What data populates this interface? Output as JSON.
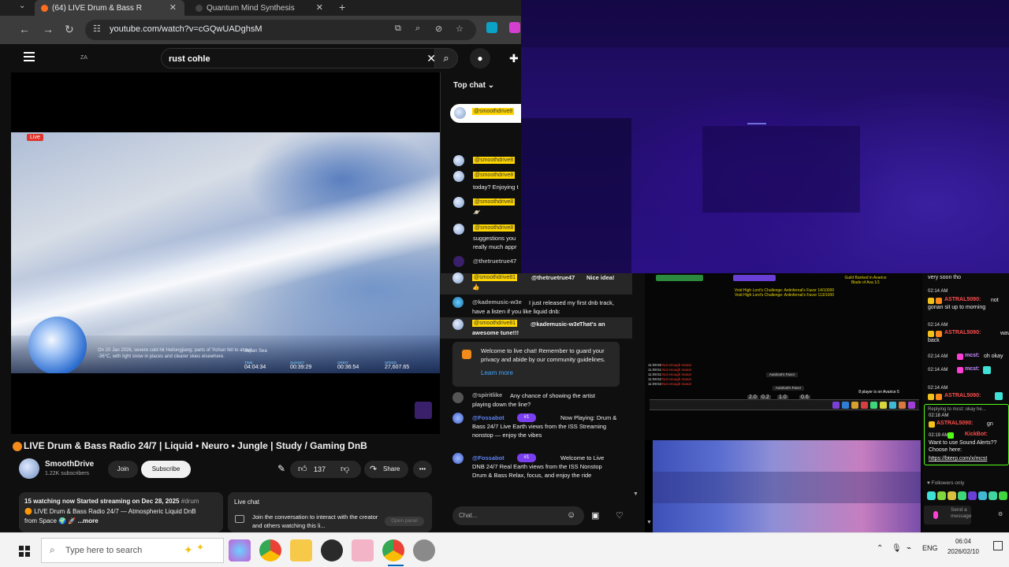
{
  "browser": {
    "tabs": [
      {
        "label": "(64)  LIVE Drum & Bass R"
      },
      {
        "label": "Quantum Mind Synthesis"
      }
    ],
    "url": "youtube.com/watch?v=cGQwUADghsM"
  },
  "youtube": {
    "logo_text": "ZA",
    "search_query": "rust cohle",
    "player": {
      "live_badge": "Live",
      "caption": "On 20 Jan 2026, severe cold hit Heilongjiang; parts of Yichun fell to about -36°C, with light snow in places and clearer skies elsewhere.",
      "location": "Japan Sea",
      "stats": [
        {
          "key": "TIME",
          "value": "04:04:34"
        },
        {
          "key": "SUNSET",
          "value": "00:39:29"
        },
        {
          "key": "ORBIT",
          "value": "00:36:54"
        },
        {
          "key": "SPEED",
          "value": "27,607.65"
        }
      ]
    },
    "video_title": "LIVE Drum & Bass Radio 24/7 | Liquid • Neuro • Jungle | Study / Gaming DnB",
    "channel": {
      "name": "SmoothDrive",
      "subscribers": "1.22K subscribers"
    },
    "buttons": {
      "join": "Join",
      "subscribe": "Subscribe",
      "likes": "137",
      "share": "Share"
    },
    "description": {
      "stats": "15 watching now  Started streaming on Dec 28, 2025",
      "tag": "#drum",
      "line2": "LIVE Drum & Bass Radio 24/7 — Atmospheric Liquid DnB",
      "line3": "from Space",
      "more": "...more"
    },
    "live_chat_panel": {
      "title": "Live chat",
      "text": "Join the conversation to interact with the creator and others watching this li...",
      "open_label": "Open panel"
    }
  },
  "chat": {
    "header": "Top chat",
    "pinned_name": "@smoothdrive8",
    "narrow_messages": [
      {
        "name": "@smoothdrive8",
        "text": ""
      },
      {
        "name": "@smoothdrive8",
        "text": "today? Enjoying t"
      },
      {
        "name": "@smoothdrive8",
        "text": ""
      },
      {
        "name": "@smoothdrive8",
        "text": "suggestions you\nreally much appr"
      },
      {
        "name": "@thetruetrue47",
        "text": ""
      }
    ],
    "wide_messages": [
      {
        "name": "@smoothdrive81",
        "mention": "@thetruetrue47",
        "text": "Nice idea!"
      },
      {
        "name": "@kademusic-w3e",
        "text": "I just released my first dnb track, have a listen if you like liquid dnb:"
      },
      {
        "name": "@smoothdrive81",
        "mention": "@kademusic-w3e",
        "text": "That's an awesome tune!!!"
      }
    ],
    "welcome_text": "Welcome to live chat! Remember to guard your privacy and abide by our community guidelines.",
    "learn_more": "Learn more",
    "spirit": {
      "name": "@spiritlike",
      "text": "Any chance of showing the artist playing down the line?"
    },
    "fossabot": [
      {
        "name": "@Fossabot",
        "badge": "#1",
        "text": "Now Playing: Drum & Bass 24/7  Live Earth views from the ISS  Streaming nonstop — enjoy the vibes"
      },
      {
        "name": "@Fossabot",
        "badge": "#1",
        "text": "Welcome to Live DNB 24/7 Real Earth views from the ISS  Nonstop Drum & Bass  Relax, focus, and enjoy the ride"
      }
    ],
    "input_placeholder": "Chat..."
  },
  "game": {
    "title1": "Void High Lord's Challenge: Antinfernal's Favor 14/10000",
    "title2": "Void High Lord's Challenge: Antinfernal's Favor 113/1000",
    "right_title": "Guild Banked in Avarice\nBlade of Ava 1/1",
    "errors": [
      "Not enough mana!",
      "Not enough mana!",
      "Not enough mana!",
      "Not enough mana!",
      "Not enough mana!"
    ],
    "times": [
      "11:09:50",
      "11:09:51",
      "11:09:51",
      "11:09:52",
      "11:09:53"
    ],
    "right_note": "8 player is on Avarice 5",
    "nameplate1": "Autoloot's Favor",
    "nameplate2": "Autoloot's Favor",
    "hotbar_nums": [
      "2.0",
      "0.2",
      "1.0",
      "0.6"
    ]
  },
  "kick": {
    "top_text": "very soon tho",
    "messages": [
      {
        "time": "02:14 AM",
        "name": "ASTRAL5090:",
        "name_color": "#ff4d4d",
        "text": "not gonan sit up to morning"
      },
      {
        "time": "02:14 AM",
        "name": "ASTRAL5090:",
        "name_color": "#ff4d4d",
        "text": "wave back"
      },
      {
        "time": "02:14 AM",
        "name": "mcst:",
        "name_color": "#c58cff",
        "text": "oh okay"
      },
      {
        "time": "02:14 AM",
        "name": "mcst:",
        "name_color": "#c58cff",
        "text": ""
      },
      {
        "time": "02:14 AM",
        "name": "ASTRAL5090:",
        "name_color": "#ff4d4d",
        "text": ""
      }
    ],
    "reply_to": "Replying to mcst: okay he...",
    "reply_time": "02:18 AM",
    "reply_name": "ASTRAL5090:",
    "reply_text": "gn",
    "bot_time": "02:19 AM",
    "bot_name": "KickBot:",
    "bot_text": "Want to use Sound Alerts?? Choose here:",
    "bot_link": "https://bterp.com/x/mcst",
    "followers_only": "Followers only",
    "send_label": "Send a message"
  },
  "taskbar": {
    "search_placeholder": "Type here to search",
    "lang": "ENG",
    "time": "06:04",
    "date": "2026/02/10"
  }
}
